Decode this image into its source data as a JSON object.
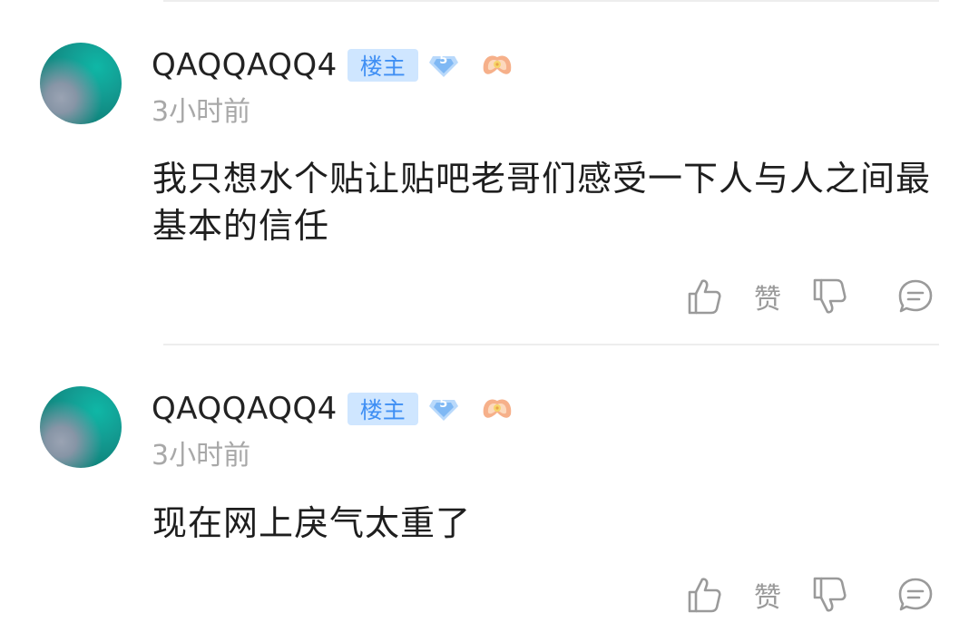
{
  "comments": [
    {
      "username": "QAQQAQQ4",
      "owner_badge": "楼主",
      "level": "5",
      "time": "3小时前",
      "text": "我只想水个贴让贴吧老哥们感受一下人与人之间最基本的信任",
      "like_label": "赞",
      "icons": {
        "like": "thumbs-up-icon",
        "dislike": "thumbs-down-icon",
        "reply": "comment-icon",
        "fan": "fan-badge-icon",
        "level": "diamond-level-icon"
      }
    },
    {
      "username": "QAQQAQQ4",
      "owner_badge": "楼主",
      "level": "5",
      "time": "3小时前",
      "text": "现在网上戾气太重了",
      "like_label": "赞",
      "icons": {
        "like": "thumbs-up-icon",
        "dislike": "thumbs-down-icon",
        "reply": "comment-icon",
        "fan": "fan-badge-icon",
        "level": "diamond-level-icon"
      }
    }
  ],
  "colors": {
    "owner_badge_bg": "#cfe6ff",
    "owner_badge_text": "#3f8ff4",
    "timestamp": "#a8a8a8",
    "icon_gray": "#9a9a9a",
    "avatar_teal": "#139d93"
  }
}
